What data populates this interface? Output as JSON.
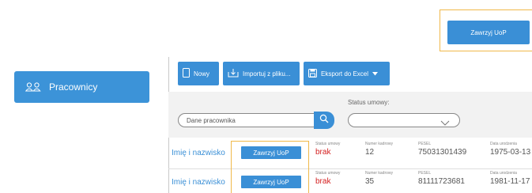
{
  "header": {
    "uop_button_label": "Zawrzyj UoP"
  },
  "sidebar": {
    "items": [
      {
        "label": "Pracownicy",
        "icon": "users-icon"
      }
    ]
  },
  "toolbar": {
    "new_label": "Nowy",
    "import_label": "Importuj z pliku...",
    "export_label": "Eksport do Excel"
  },
  "filters": {
    "search_placeholder": "Dane pracownika",
    "status_label": "Status umowy:",
    "status_value": ""
  },
  "columns": {
    "status": "Status umowy",
    "number": "Numer kadrowy",
    "pesel": "PESEL",
    "birth": "Data urodzenia"
  },
  "rows": [
    {
      "name": "Imię i nazwisko",
      "button": "Zawrzyj UoP",
      "status": "brak",
      "number": "12",
      "pesel": "75031301439",
      "birth": "1975-03-13"
    },
    {
      "name": "Imię i nazwisko",
      "button": "Zawrzyj UoP",
      "status": "brak",
      "number": "35",
      "pesel": "81111723681",
      "birth": "1981-11-17"
    }
  ],
  "colors": {
    "accent": "#3a8fd6",
    "highlight": "#f0b94a",
    "status_red": "#d42020"
  }
}
